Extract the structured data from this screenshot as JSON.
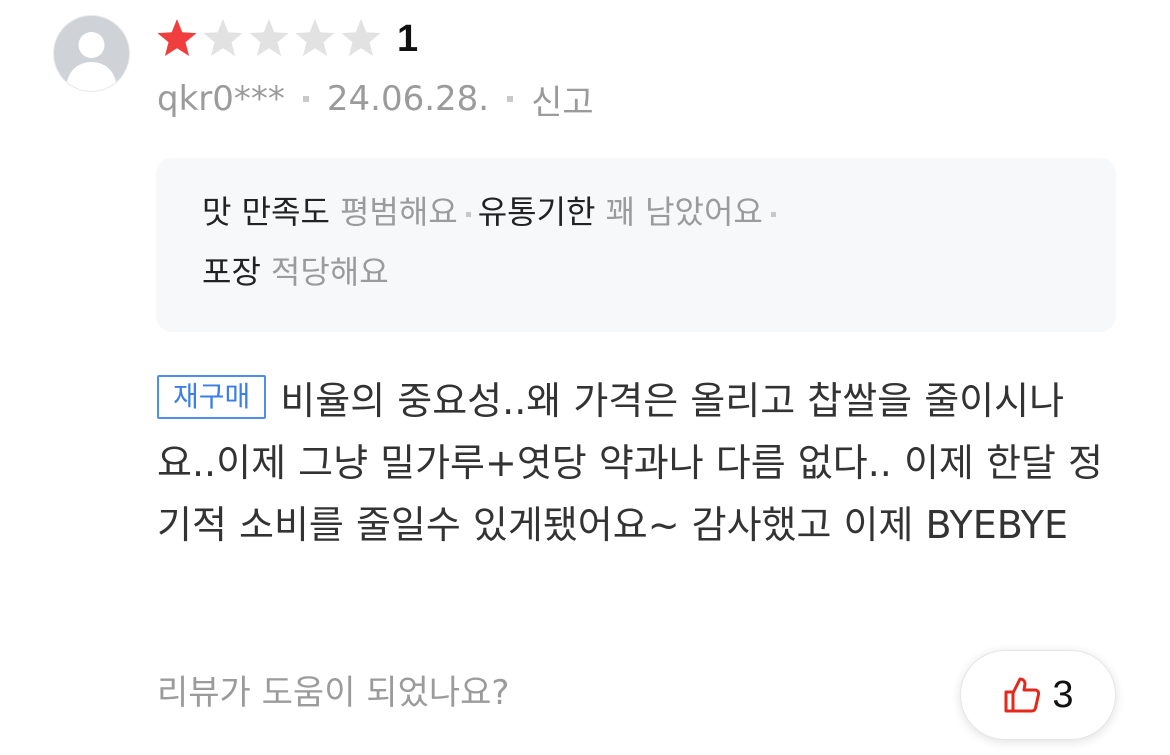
{
  "review": {
    "rating": 1,
    "rating_max": 5,
    "rating_label": "1",
    "user": "qkr0***",
    "date": "24.06.28.",
    "report_label": "신고",
    "attributes": [
      {
        "key": "맛 만족도",
        "value": "평범해요"
      },
      {
        "key": "유통기한",
        "value": "꽤 남았어요"
      },
      {
        "key": "포장",
        "value": "적당해요"
      }
    ],
    "badge": "재구매",
    "body": "비율의 중요성..왜 가격은 올리고 찹쌀을 줄이시나요..이제 그냥 밀가루+엿당 약과나 다름 없다.. 이제 한달 정기적 소비를 줄일수 있게됐어요~ 감사했고 이제 BYEBYE",
    "helpful_prompt": "리뷰가 도움이 되었나요?",
    "like_count": "3"
  },
  "icons": {
    "avatar": "person-silhouette-icon",
    "star_filled": "star-filled-icon",
    "star_empty": "star-empty-icon",
    "like": "thumbs-up-icon"
  },
  "colors": {
    "star_filled": "#f03e3e",
    "star_empty": "#e2e2e2",
    "badge": "#3b7ee8",
    "like_icon": "#e4291c",
    "muted_text": "#9b9b9b"
  }
}
